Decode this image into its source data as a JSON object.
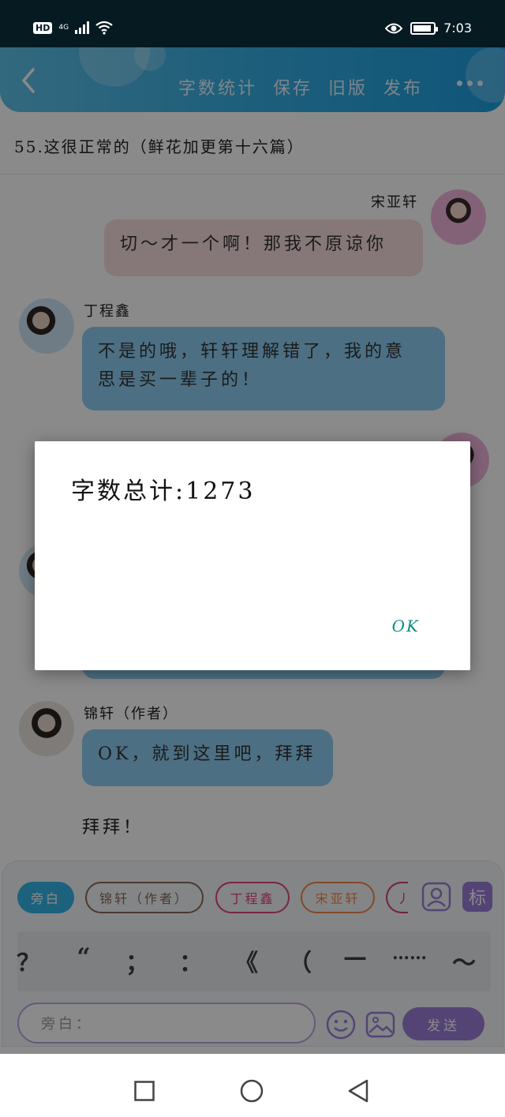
{
  "status_bar": {
    "hd": "HD",
    "network": "4G",
    "time": "7:03"
  },
  "app_bar": {
    "actions": [
      "字数统计",
      "保存",
      "旧版",
      "发布"
    ]
  },
  "chapter_title": "55.这很正常的（鲜花加更第十六篇）",
  "messages": [
    {
      "speaker": "宋亚轩",
      "text": "切～才一个啊！那我不原谅你"
    },
    {
      "speaker": "丁程鑫",
      "lines": [
        "不是的哦，轩轩理解错了，我的意",
        "思是买一辈子的！"
      ]
    },
    {
      "speaker": "锦轩（作者）",
      "text": "OK，就到这里吧，拜拜"
    },
    {
      "text": "拜拜！"
    }
  ],
  "role_chips": [
    {
      "label": "旁白",
      "color": "#34b6e8"
    },
    {
      "label": "锦轩（作者）",
      "color": "#8a6a5a"
    },
    {
      "label": "丁程鑫",
      "color": "#e0457b"
    },
    {
      "label": "宋亚轩",
      "color": "#ef8a4a"
    },
    {
      "label": "丿",
      "color": "#d33e6f"
    }
  ],
  "tag_button": "标",
  "punctuation": [
    "？",
    "“",
    "；",
    "：",
    "《",
    "（",
    "—",
    "……",
    "～"
  ],
  "input": {
    "placeholder": "旁白："
  },
  "send_label": "发送",
  "dialog": {
    "message": "字数总计:1273",
    "ok_label": "OK"
  }
}
